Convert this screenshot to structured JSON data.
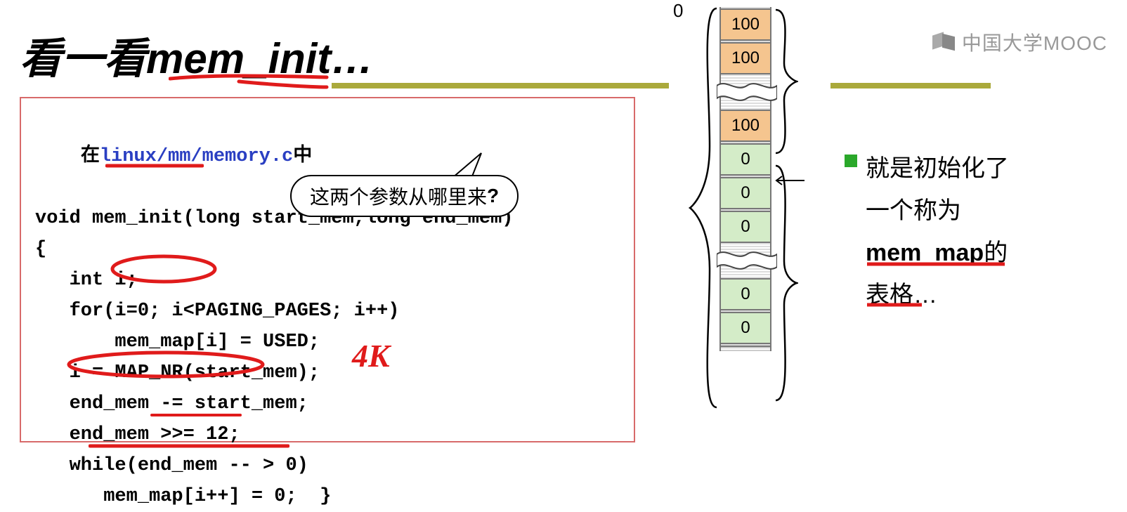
{
  "heading": {
    "zh": "看一看",
    "fn": "mem_init…"
  },
  "watermark": "中国大学MOOC",
  "code": {
    "file_prefix": "在",
    "file_path": "linux/mm/memory.c",
    "file_suffix": "中",
    "l1": "void mem_init(long start_mem,long end_mem)",
    "l2": "{",
    "l3": "   int i;",
    "l4": "   for(i=0; i<PAGING_PAGES; i++)",
    "l5": "       mem_map[i] = USED;",
    "l6": "   i = MAP_NR(start_mem);",
    "l7": "   end_mem -= start_mem;",
    "l8": "   end_mem >>= 12;",
    "l9": "   while(end_mem -- > 0)",
    "l10": "      mem_map[i++] = 0;  }"
  },
  "bubble": {
    "text": "这两个参数从哪里来",
    "q": "?"
  },
  "hand4k": "4K",
  "diagram": {
    "zero": "0",
    "cells": [
      {
        "v": "100",
        "c": "orange"
      },
      {
        "v": "100",
        "c": "orange"
      },
      {
        "gap": true,
        "c": "orange"
      },
      {
        "v": "100",
        "c": "orange"
      },
      {
        "v": "0",
        "c": "green"
      },
      {
        "v": "0",
        "c": "green"
      },
      {
        "v": "0",
        "c": "green"
      },
      {
        "gap": true,
        "c": "green"
      },
      {
        "v": "0",
        "c": "green"
      },
      {
        "v": "0",
        "c": "green"
      }
    ]
  },
  "right": {
    "t1": "就是初始化了",
    "t2": "一个称为",
    "mm": "mem_map",
    "t3": "的",
    "t4": "表格…"
  }
}
